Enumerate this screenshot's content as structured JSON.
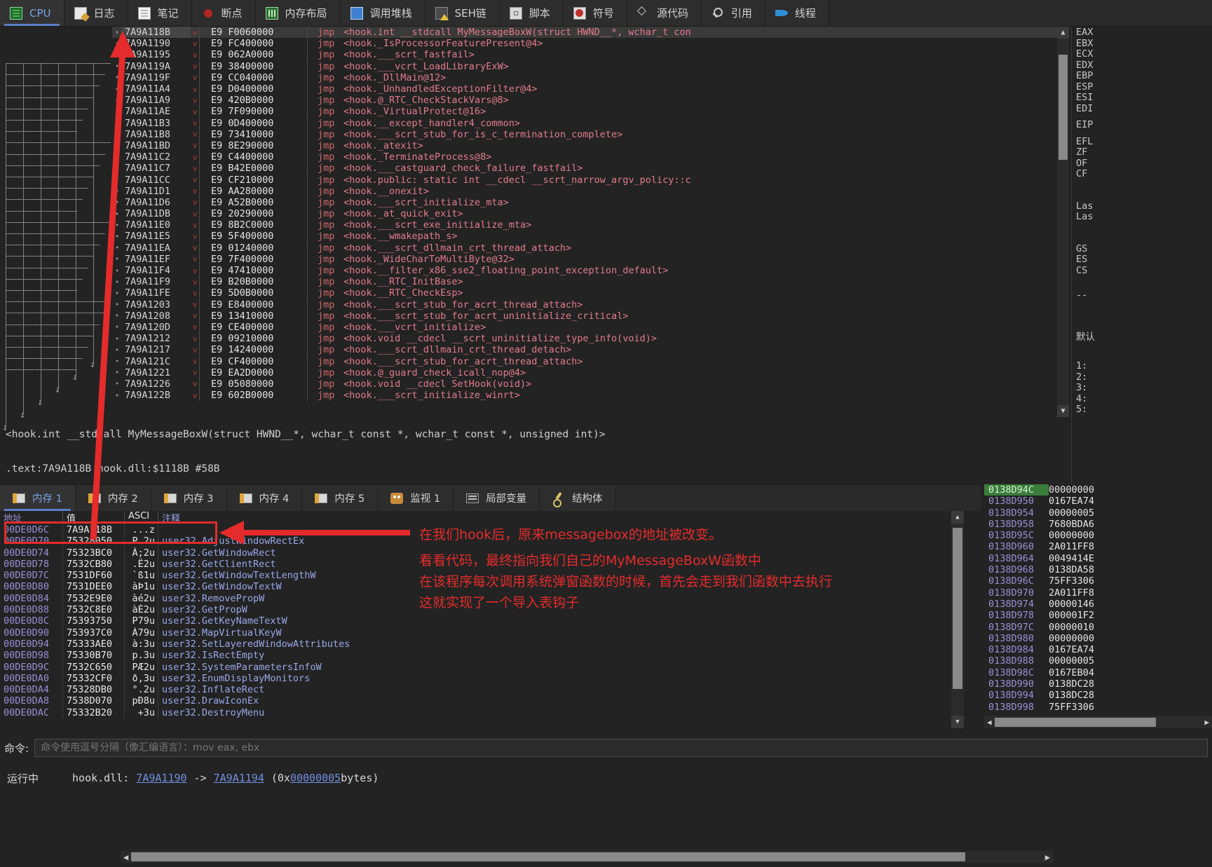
{
  "top_tabs": [
    {
      "label": "CPU",
      "icon": "cpu-icon",
      "active": true
    },
    {
      "label": "日志",
      "icon": "log-icon",
      "active": false
    },
    {
      "label": "笔记",
      "icon": "notes-icon",
      "active": false
    },
    {
      "label": "断点",
      "icon": "breakpoint-icon",
      "active": false
    },
    {
      "label": "内存布局",
      "icon": "memory-map-icon",
      "active": false
    },
    {
      "label": "调用堆栈",
      "icon": "call-stack-icon",
      "active": false
    },
    {
      "label": "SEH链",
      "icon": "seh-chain-icon",
      "active": false
    },
    {
      "label": "脚本",
      "icon": "script-icon",
      "active": false
    },
    {
      "label": "符号",
      "icon": "symbols-icon",
      "active": false
    },
    {
      "label": "源代码",
      "icon": "source-icon",
      "active": false
    },
    {
      "label": "引用",
      "icon": "references-icon",
      "active": false
    },
    {
      "label": "线程",
      "icon": "threads-icon",
      "active": false
    }
  ],
  "disassembly": {
    "rows": [
      {
        "addr": "7A9A118B",
        "bytes": "E9 F0060000",
        "mn": "jmp",
        "ops": "<hook.int __stdcall MyMessageBoxW(struct HWND__*, wchar_t con",
        "selected": true
      },
      {
        "addr": "7A9A1190",
        "bytes": "E9 FC400000",
        "mn": "jmp",
        "ops": "<hook._IsProcessorFeaturePresent@4>",
        "selected": false
      },
      {
        "addr": "7A9A1195",
        "bytes": "E9 062A0000",
        "mn": "jmp",
        "ops": "<hook.___scrt_fastfail>",
        "selected": false
      },
      {
        "addr": "7A9A119A",
        "bytes": "E9 38400000",
        "mn": "jmp",
        "ops": "<hook.___vcrt_LoadLibraryExW>",
        "selected": false
      },
      {
        "addr": "7A9A119F",
        "bytes": "E9 CC040000",
        "mn": "jmp",
        "ops": "<hook._DllMain@12>",
        "selected": false
      },
      {
        "addr": "7A9A11A4",
        "bytes": "E9 D0400000",
        "mn": "jmp",
        "ops": "<hook._UnhandledExceptionFilter@4>",
        "selected": false
      },
      {
        "addr": "7A9A11A9",
        "bytes": "E9 420B0000",
        "mn": "jmp",
        "ops": "<hook.@_RTC_CheckStackVars@8>",
        "selected": false
      },
      {
        "addr": "7A9A11AE",
        "bytes": "E9 7F090000",
        "mn": "jmp",
        "ops": "<hook._VirtualProtect@16>",
        "selected": false
      },
      {
        "addr": "7A9A11B3",
        "bytes": "E9 0D400000",
        "mn": "jmp",
        "ops": "<hook.__except_handler4_common>",
        "selected": false
      },
      {
        "addr": "7A9A11B8",
        "bytes": "E9 73410000",
        "mn": "jmp",
        "ops": "<hook.___scrt_stub_for_is_c_termination_complete>",
        "selected": false
      },
      {
        "addr": "7A9A11BD",
        "bytes": "E9 8E290000",
        "mn": "jmp",
        "ops": "<hook._atexit>",
        "selected": false
      },
      {
        "addr": "7A9A11C2",
        "bytes": "E9 C4400000",
        "mn": "jmp",
        "ops": "<hook._TerminateProcess@8>",
        "selected": false
      },
      {
        "addr": "7A9A11C7",
        "bytes": "E9 B42E0000",
        "mn": "jmp",
        "ops": "<hook.___castguard_check_failure_fastfail>",
        "selected": false
      },
      {
        "addr": "7A9A11CC",
        "bytes": "E9 CF210000",
        "mn": "jmp",
        "ops": "<hook.public: static int __cdecl __scrt_narrow_argv_policy::c",
        "selected": false
      },
      {
        "addr": "7A9A11D1",
        "bytes": "E9 AA280000",
        "mn": "jmp",
        "ops": "<hook.__onexit>",
        "selected": false
      },
      {
        "addr": "7A9A11D6",
        "bytes": "E9 A52B0000",
        "mn": "jmp",
        "ops": "<hook.___scrt_initialize_mta>",
        "selected": false
      },
      {
        "addr": "7A9A11DB",
        "bytes": "E9 20290000",
        "mn": "jmp",
        "ops": "<hook._at_quick_exit>",
        "selected": false
      },
      {
        "addr": "7A9A11E0",
        "bytes": "E9 8B2C0000",
        "mn": "jmp",
        "ops": "<hook.___scrt_exe_initialize_mta>",
        "selected": false
      },
      {
        "addr": "7A9A11E5",
        "bytes": "E9 5F400000",
        "mn": "jmp",
        "ops": "<hook.__wmakepath_s>",
        "selected": false
      },
      {
        "addr": "7A9A11EA",
        "bytes": "E9 01240000",
        "mn": "jmp",
        "ops": "<hook.___scrt_dllmain_crt_thread_attach>",
        "selected": false
      },
      {
        "addr": "7A9A11EF",
        "bytes": "E9 7F400000",
        "mn": "jmp",
        "ops": "<hook._WideCharToMultiByte@32>",
        "selected": false
      },
      {
        "addr": "7A9A11F4",
        "bytes": "E9 47410000",
        "mn": "jmp",
        "ops": "<hook.__filter_x86_sse2_floating_point_exception_default>",
        "selected": false
      },
      {
        "addr": "7A9A11F9",
        "bytes": "E9 B20B0000",
        "mn": "jmp",
        "ops": "<hook.__RTC_InitBase>",
        "selected": false
      },
      {
        "addr": "7A9A11FE",
        "bytes": "E9 5D0B0000",
        "mn": "jmp",
        "ops": "<hook.__RTC_CheckEsp>",
        "selected": false
      },
      {
        "addr": "7A9A1203",
        "bytes": "E9 E8400000",
        "mn": "jmp",
        "ops": "<hook.___scrt_stub_for_acrt_thread_attach>",
        "selected": false
      },
      {
        "addr": "7A9A1208",
        "bytes": "E9 13410000",
        "mn": "jmp",
        "ops": "<hook.___scrt_stub_for_acrt_uninitialize_critical>",
        "selected": false
      },
      {
        "addr": "7A9A120D",
        "bytes": "E9 CE400000",
        "mn": "jmp",
        "ops": "<hook.___vcrt_initialize>",
        "selected": false
      },
      {
        "addr": "7A9A1212",
        "bytes": "E9 09210000",
        "mn": "jmp",
        "ops": "<hook.void __cdecl __scrt_uninitialize_type_info(void)>",
        "selected": false
      },
      {
        "addr": "7A9A1217",
        "bytes": "E9 14240000",
        "mn": "jmp",
        "ops": "<hook.___scrt_dllmain_crt_thread_detach>",
        "selected": false
      },
      {
        "addr": "7A9A121C",
        "bytes": "E9 CF400000",
        "mn": "jmp",
        "ops": "<hook.___scrt_stub_for_acrt_thread_attach>",
        "selected": false
      },
      {
        "addr": "7A9A1221",
        "bytes": "E9 EA2D0000",
        "mn": "jmp",
        "ops": "<hook.@_guard_check_icall_nop@4>",
        "selected": false
      },
      {
        "addr": "7A9A1226",
        "bytes": "E9 05080000",
        "mn": "jmp",
        "ops": "<hook.void __cdecl SetHook(void)>",
        "selected": false
      },
      {
        "addr": "7A9A122B",
        "bytes": "E9 602B0000",
        "mn": "jmp",
        "ops": "<hook.___scrt_initialize_winrt>",
        "selected": false
      }
    ]
  },
  "info": {
    "line1": "<hook.int __stdcall MyMessageBoxW(struct HWND__*, wchar_t const *, wchar_t const *, unsigned int)>",
    "line2": ".text:7A9A118B hook.dll:$1118B #58B"
  },
  "registers": [
    "EAX",
    "EBX",
    "ECX",
    "EDX",
    "EBP",
    "ESP",
    "ESI",
    "EDI",
    "EIP",
    "EFL",
    "ZF",
    "OF",
    "CF",
    "Las",
    "Las",
    "GS",
    "ES",
    "CS",
    "--",
    "默认",
    "1:",
    "2:",
    "3:",
    "4:",
    "5:"
  ],
  "bottom_tabs": [
    {
      "label": "内存 1",
      "icon": "dump-icon",
      "active": true
    },
    {
      "label": "内存 2",
      "icon": "dump-icon",
      "active": false
    },
    {
      "label": "内存 3",
      "icon": "dump-icon",
      "active": false
    },
    {
      "label": "内存 4",
      "icon": "dump-icon",
      "active": false
    },
    {
      "label": "内存 5",
      "icon": "dump-icon",
      "active": false
    },
    {
      "label": "监视 1",
      "icon": "watch-icon",
      "active": false
    },
    {
      "label": "局部变量",
      "icon": "locals-icon",
      "active": false
    },
    {
      "label": "结构体",
      "icon": "struct-icon",
      "active": false
    }
  ],
  "dump": {
    "headers": [
      "地址",
      "值",
      "ASCI",
      "注释"
    ],
    "rows": [
      {
        "addr": "00DE0D6C",
        "value": "7A9A118B",
        "ascii": "...z",
        "comment": "",
        "highlight": true
      },
      {
        "addr": "00DE0D70",
        "value": "75328050",
        "ascii": "P.2u",
        "comment": "user32.AdjustWindowRectEx",
        "highlight": false
      },
      {
        "addr": "00DE0D74",
        "value": "75323BC0",
        "ascii": "À;2u",
        "comment": "user32.GetWindowRect",
        "highlight": false
      },
      {
        "addr": "00DE0D78",
        "value": "7532CB80",
        "ascii": ".Ë2u",
        "comment": "user32.GetClientRect",
        "highlight": false
      },
      {
        "addr": "00DE0D7C",
        "value": "7531DF60",
        "ascii": "`ß1u",
        "comment": "user32.GetWindowTextLengthW",
        "highlight": false
      },
      {
        "addr": "00DE0D80",
        "value": "7531DEE0",
        "ascii": "àÞ1u",
        "comment": "user32.GetWindowTextW",
        "highlight": false
      },
      {
        "addr": "00DE0D84",
        "value": "7532E9E0",
        "ascii": "àé2u",
        "comment": "user32.RemovePropW",
        "highlight": false
      },
      {
        "addr": "00DE0D88",
        "value": "7532C8E0",
        "ascii": "àÈ2u",
        "comment": "user32.GetPropW",
        "highlight": false
      },
      {
        "addr": "00DE0D8C",
        "value": "75393750",
        "ascii": "P79u",
        "comment": "user32.GetKeyNameTextW",
        "highlight": false
      },
      {
        "addr": "00DE0D90",
        "value": "753937C0",
        "ascii": "À79u",
        "comment": "user32.MapVirtualKeyW",
        "highlight": false
      },
      {
        "addr": "00DE0D94",
        "value": "75333AE0",
        "ascii": "à:3u",
        "comment": "user32.SetLayeredWindowAttributes",
        "highlight": false
      },
      {
        "addr": "00DE0D98",
        "value": "75330B70",
        "ascii": "p.3u",
        "comment": "user32.IsRectEmpty",
        "highlight": false
      },
      {
        "addr": "00DE0D9C",
        "value": "7532C650",
        "ascii": "PÆ2u",
        "comment": "user32.SystemParametersInfoW",
        "highlight": false
      },
      {
        "addr": "00DE0DA0",
        "value": "75332CF0",
        "ascii": "ð,3u",
        "comment": "user32.EnumDisplayMonitors",
        "highlight": false
      },
      {
        "addr": "00DE0DA4",
        "value": "75328DB0",
        "ascii": "°.2u",
        "comment": "user32.InflateRect",
        "highlight": false
      },
      {
        "addr": "00DE0DA8",
        "value": "7538D070",
        "ascii": "pÐ8u",
        "comment": "user32.DrawIconEx",
        "highlight": false
      },
      {
        "addr": "00DE0DAC",
        "value": "75332B20",
        "ascii": " +3u",
        "comment": "user32.DestroyMenu",
        "highlight": false
      }
    ]
  },
  "stack": {
    "rows": [
      {
        "addr": "0138D94C",
        "value": "00000000",
        "highlight": true
      },
      {
        "addr": "0138D950",
        "value": "0167EA74",
        "highlight": false
      },
      {
        "addr": "0138D954",
        "value": "00000005",
        "highlight": false
      },
      {
        "addr": "0138D958",
        "value": "7680BDA6",
        "highlight": false
      },
      {
        "addr": "0138D95C",
        "value": "00000000",
        "highlight": false
      },
      {
        "addr": "0138D960",
        "value": "2A011FF8",
        "highlight": false
      },
      {
        "addr": "0138D964",
        "value": "0049414E",
        "highlight": false
      },
      {
        "addr": "0138D968",
        "value": "0138DA58",
        "highlight": false
      },
      {
        "addr": "0138D96C",
        "value": "75FF3306",
        "highlight": false
      },
      {
        "addr": "0138D970",
        "value": "2A011FF8",
        "highlight": false
      },
      {
        "addr": "0138D974",
        "value": "00000146",
        "highlight": false
      },
      {
        "addr": "0138D978",
        "value": "000001F2",
        "highlight": false
      },
      {
        "addr": "0138D97C",
        "value": "00000010",
        "highlight": false
      },
      {
        "addr": "0138D980",
        "value": "00000000",
        "highlight": false
      },
      {
        "addr": "0138D984",
        "value": "0167EA74",
        "highlight": false
      },
      {
        "addr": "0138D988",
        "value": "00000005",
        "highlight": false
      },
      {
        "addr": "0138D98C",
        "value": "0167EB04",
        "highlight": false
      },
      {
        "addr": "0138D990",
        "value": "0138DC28",
        "highlight": false
      },
      {
        "addr": "0138D994",
        "value": "0138DC28",
        "highlight": false
      },
      {
        "addr": "0138D998",
        "value": "75FF3306",
        "highlight": false
      }
    ]
  },
  "annotations": [
    "在我们hook后，原来messagebox的地址被改变。",
    "看看代码，最终指向我们自己的MyMessageBoxW函数中",
    "在该程序每次调用系统弹窗函数的时候，首先会走到我们函数中去执行",
    "这就实现了一个导入表钩子"
  ],
  "command": {
    "label": "命令:",
    "placeholder": "命令使用逗号分隔（像汇编语言）：mov eax, ebx"
  },
  "status": {
    "state": "运行中",
    "module": "hook.dll:",
    "from": "7A9A1190",
    "arrow": "->",
    "to": "7A9A1194",
    "size_open": "(0x",
    "size": "00000005",
    "size_close": " bytes)"
  },
  "colors": {
    "accent": "#5b7fc7",
    "annotation_red": "#e52b2b",
    "mnemonic": "#cf6a6a",
    "operand": "#e27c8d",
    "dump_comment": "#9aa7e8"
  }
}
